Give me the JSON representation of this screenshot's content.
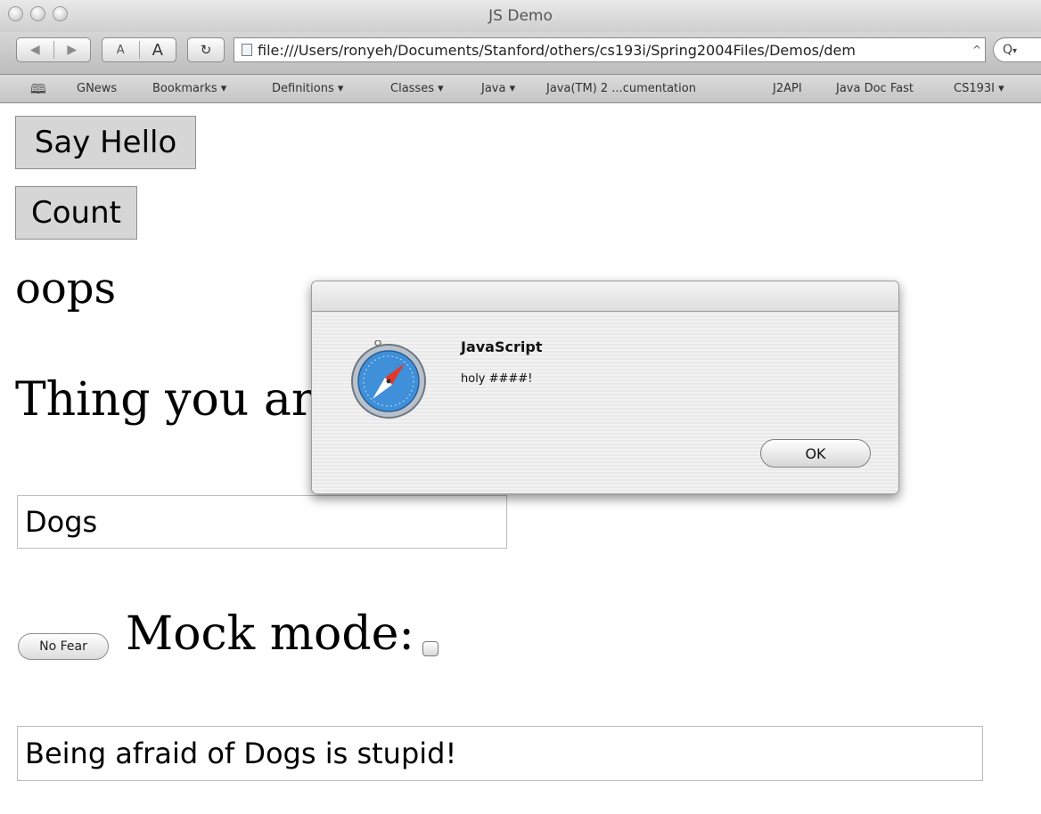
{
  "window": {
    "title": "JS Demo"
  },
  "toolbar": {
    "back_icon": "◀",
    "forward_icon": "▶",
    "text_smaller": "A",
    "text_bigger": "A",
    "reload_icon": "↻",
    "url": "file:///Users/ronyeh/Documents/Stanford/others/cs193i/Spring2004Files/Demos/dem",
    "search_icon": "Q"
  },
  "bookmarks": {
    "items": [
      "GNews",
      "Bookmarks ▾",
      "Definitions ▾",
      "Classes ▾",
      "Java ▾",
      "Java(TM) 2 ...cumentation",
      "J2API",
      "Java Doc Fast",
      "CS193I ▾"
    ]
  },
  "page": {
    "say_hello_label": "Say Hello",
    "count_label": "Count",
    "oops_text": "oops",
    "prompt_text": "Thing you are",
    "thing_value": "Dogs",
    "no_fear_label": "No Fear",
    "mock_mode_label": "Mock mode:",
    "result_value": "Being afraid of Dogs is stupid!"
  },
  "alert": {
    "title": "JavaScript",
    "message": "holy ####!",
    "ok_label": "OK"
  }
}
